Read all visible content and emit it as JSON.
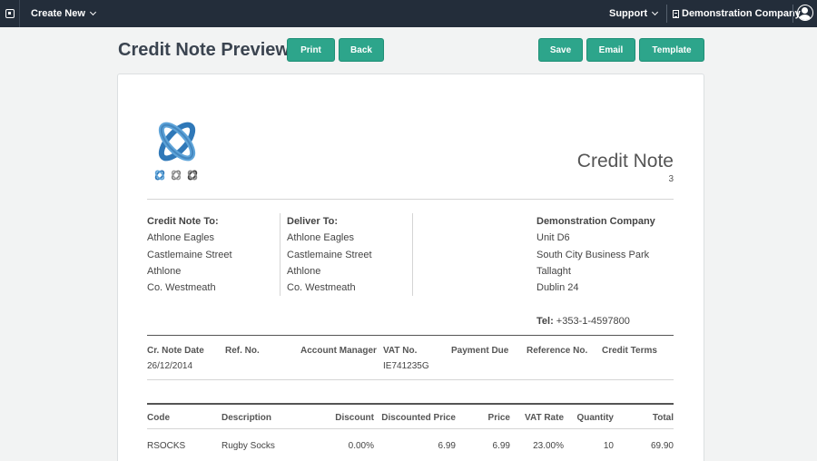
{
  "nav": {
    "create_new": "Create New",
    "support": "Support",
    "company": "Demonstration Company"
  },
  "page": {
    "title": "Credit Note Preview",
    "buttons": {
      "print": "Print",
      "back": "Back",
      "save": "Save",
      "email": "Email",
      "template": "Template"
    }
  },
  "document": {
    "title": "Credit Note",
    "number": "3",
    "credit_note_to": {
      "heading": "Credit Note To:",
      "lines": [
        "Athlone Eagles",
        "Castlemaine Street",
        "Athlone",
        "Co. Westmeath"
      ]
    },
    "deliver_to": {
      "heading": "Deliver To:",
      "lines": [
        "Athlone Eagles",
        "Castlemaine Street",
        "Athlone",
        "Co. Westmeath"
      ]
    },
    "company": {
      "name": "Demonstration Company",
      "lines": [
        "Unit D6",
        "South City Business Park",
        "Tallaght",
        "Dublin 24"
      ],
      "tel_label": "Tel:",
      "tel_value": " +353-1-4597800"
    },
    "details": {
      "headers": {
        "date": "Cr. Note Date",
        "ref": "Ref. No.",
        "manager": "Account Manager",
        "vat_no": "VAT No.",
        "payment_due": "Payment Due",
        "reference_no": "Reference No.",
        "credit_terms": "Credit Terms"
      },
      "values": {
        "date": "26/12/2014",
        "vat_no": "IE741235G"
      }
    },
    "items": {
      "headers": {
        "code": "Code",
        "description": "Description",
        "discount": "Discount",
        "discounted_price": "Discounted Price",
        "price": "Price",
        "vat_rate": "VAT Rate",
        "quantity": "Quantity",
        "total": "Total"
      },
      "rows": [
        {
          "code": "RSOCKS",
          "description": "Rugby Socks",
          "discount": "0.00%",
          "discounted_price": "6.99",
          "price": "6.99",
          "vat_rate": "23.00%",
          "quantity": "10",
          "total": "69.90"
        }
      ]
    }
  },
  "colors": {
    "topbar": "#232d3a",
    "accent": "#2da58b",
    "logo_blue": "#2f78b8"
  }
}
